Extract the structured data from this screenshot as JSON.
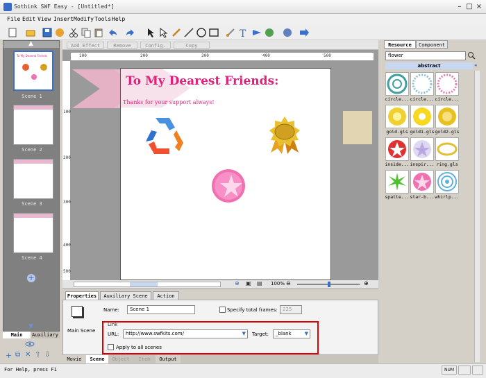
{
  "window": {
    "title": "Sothink SWF Easy - [Untitled*]"
  },
  "menu": [
    "File",
    "Edit",
    "View",
    "Insert",
    "Modify",
    "Tools",
    "Help"
  ],
  "effects_bar": {
    "add_effect": "Add Effect",
    "remove": "Remove",
    "config": "Config.",
    "copy_effects": "Copy Effects"
  },
  "ruler": {
    "h": [
      "100",
      "200",
      "300",
      "400",
      "500"
    ],
    "v": [
      "100",
      "200",
      "300",
      "400",
      "500"
    ]
  },
  "canvas": {
    "heading": "To My Dearest Friends:",
    "subtext": "Thanks for your support always!",
    "zoom": "100%"
  },
  "scenes": [
    {
      "label": "Scene 1",
      "selected": true
    },
    {
      "label": "Scene 2"
    },
    {
      "label": "Scene 3"
    },
    {
      "label": "Scene 4"
    }
  ],
  "scene_tabs": {
    "main": "Main",
    "auxiliary": "Auxiliary"
  },
  "properties": {
    "tabs": [
      "Properties",
      "Auxiliary Scene",
      "Action"
    ],
    "left_label": "Main Scene",
    "name_label": "Name:",
    "name_value": "Scene 1",
    "specify_frames": "Specify total frames:",
    "frames_value": "225",
    "link_group": "Link",
    "url_label": "URL:",
    "url_value": "http://www.swfkits.com/",
    "target_label": "Target:",
    "target_value": "_blank",
    "apply_all": "Apply to all scenes"
  },
  "bottom_tabs": [
    "Movie",
    "Scene",
    "Object",
    "Item",
    "Output"
  ],
  "resource": {
    "tabs": [
      "Resource",
      "Component"
    ],
    "search_value": "flower",
    "category": "abstract",
    "items": [
      "circle...",
      "circle...",
      "circle...",
      "gold.gls",
      "gold1.gls",
      "gold2.gls",
      "inside...",
      "inspir...",
      "ring.gls",
      "spatte...",
      "star-b...",
      "whirlp..."
    ]
  },
  "status": {
    "text": "For Help, press F1",
    "right": "NUM"
  },
  "colors": {
    "heading": "#e0207a",
    "highlight": "#e00000",
    "panel_header": "#c8d8f0"
  }
}
